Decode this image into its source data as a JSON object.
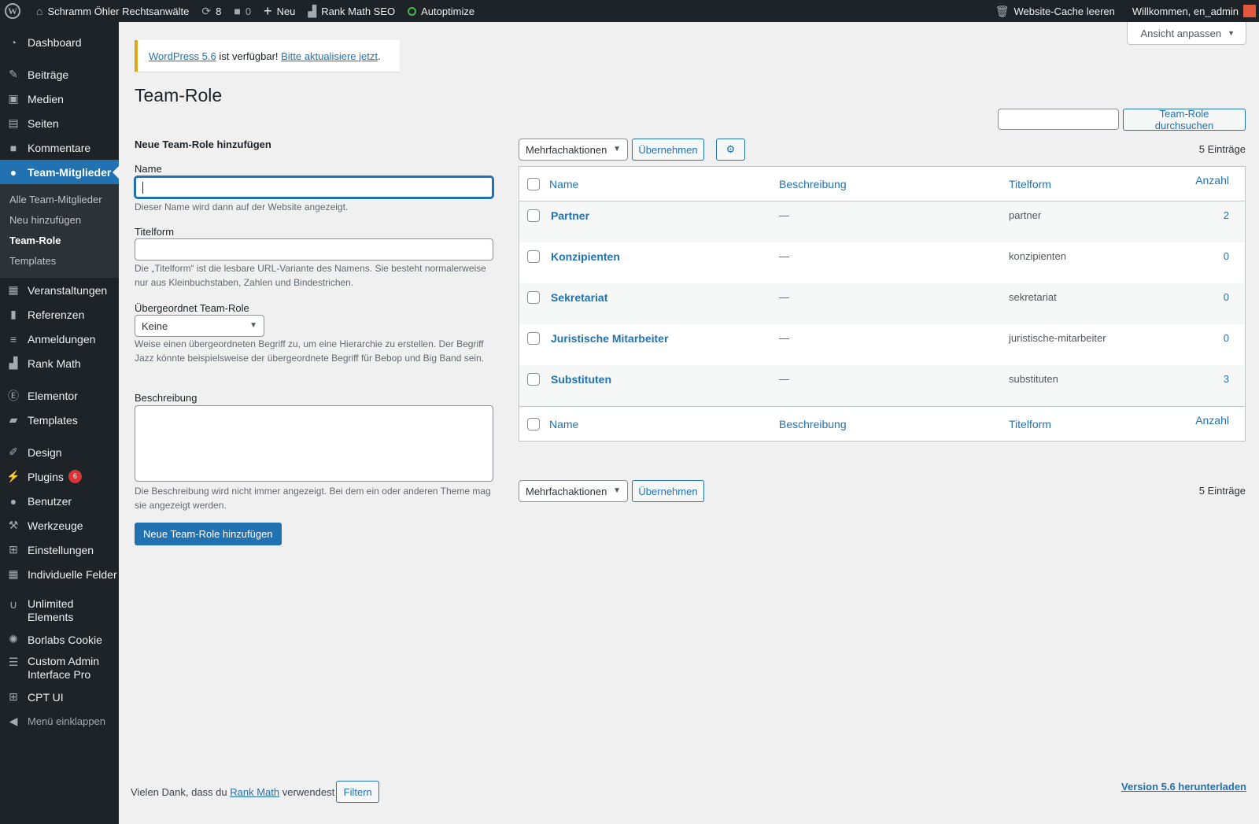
{
  "adminbar": {
    "site_name": "Schramm Öhler Rechtsanwälte",
    "updates_count": "8",
    "comments_count": "0",
    "new_label": "Neu",
    "rankmath_label": "Rank Math SEO",
    "autoptimize_label": "Autoptimize",
    "cache_label": "Website-Cache leeren",
    "welcome_label": "Willkommen, en_admin"
  },
  "sidebar": {
    "dashboard": "Dashboard",
    "posts": "Beiträge",
    "media": "Medien",
    "pages": "Seiten",
    "comments": "Kommentare",
    "team": "Team-Mitglieder",
    "submenu": [
      "Alle Team-Mitglieder",
      "Neu hinzufügen",
      "Team-Role",
      "Templates"
    ],
    "events": "Veranstaltungen",
    "references": "Referenzen",
    "registrations": "Anmeldungen",
    "rankmath": "Rank Math",
    "elementor": "Elementor",
    "templates": "Templates",
    "design": "Design",
    "plugins": "Plugins",
    "plugins_badge": "6",
    "users": "Benutzer",
    "tools": "Werkzeuge",
    "settings": "Einstellungen",
    "custom_fields": "Individuelle Felder",
    "unlimited": "Unlimited Elements",
    "borlabs": "Borlabs Cookie",
    "custom_admin": "Custom Admin Interface Pro",
    "cptui": "CPT UI",
    "collapse": "Menü einklappen"
  },
  "screen_options": "Ansicht anpassen",
  "notice": {
    "link1": "WordPress 5.6",
    "text": " ist verfügbar! ",
    "link2": "Bitte aktualisiere jetzt",
    "end": "."
  },
  "page_title": "Team-Role",
  "search": {
    "button": "Team-Role durchsuchen",
    "value": ""
  },
  "form": {
    "title": "Neue Team-Role hinzufügen",
    "name_label": "Name",
    "name_value": "",
    "name_desc": "Dieser Name wird dann auf der Website angezeigt.",
    "slug_label": "Titelform",
    "slug_value": "",
    "slug_desc": "Die „Titelform“ ist die lesbare URL-Variante des Namens. Sie besteht normalerweise nur aus Kleinbuchstaben, Zahlen und Bindestrichen.",
    "parent_label": "Übergeordnet Team-Role",
    "parent_value": "Keine",
    "parent_desc": "Weise einen übergeordneten Begriff zu, um eine Hierarchie zu erstellen. Der Begriff Jazz könnte beispielsweise der übergeordnete Begriff für Bebop und Big Band sein.",
    "desc_label": "Beschreibung",
    "desc_value": "",
    "desc_desc": "Die Beschreibung wird nicht immer angezeigt. Bei dem ein oder anderen Theme mag sie angezeigt werden.",
    "submit": "Neue Team-Role hinzufügen"
  },
  "list": {
    "bulk_label": "Mehrfachaktionen",
    "apply_label": "Übernehmen",
    "count": "5 Einträge",
    "columns": {
      "name": "Name",
      "description": "Beschreibung",
      "slug": "Titelform",
      "count": "Anzahl"
    },
    "rows": [
      {
        "name": "Partner",
        "description": "—",
        "slug": "partner",
        "count": "2"
      },
      {
        "name": "Konzipienten",
        "description": "—",
        "slug": "konzipienten",
        "count": "0"
      },
      {
        "name": "Sekretariat",
        "description": "—",
        "slug": "sekretariat",
        "count": "0"
      },
      {
        "name": "Juristische Mitarbeiter",
        "description": "—",
        "slug": "juristische-mitarbeiter",
        "count": "0"
      },
      {
        "name": "Substituten",
        "description": "—",
        "slug": "substituten",
        "count": "3"
      }
    ]
  },
  "footer": {
    "thanks_before": "Vielen Dank, dass du ",
    "thanks_link": "Rank Math",
    "thanks_after": " verwendest",
    "filter_button": "Filtern",
    "version_link": "Version 5.6 herunterladen"
  },
  "colors": {
    "accent": "#2271b1",
    "adminbar": "#1d2327",
    "notice_border": "#dba617",
    "badge": "#d63638"
  }
}
